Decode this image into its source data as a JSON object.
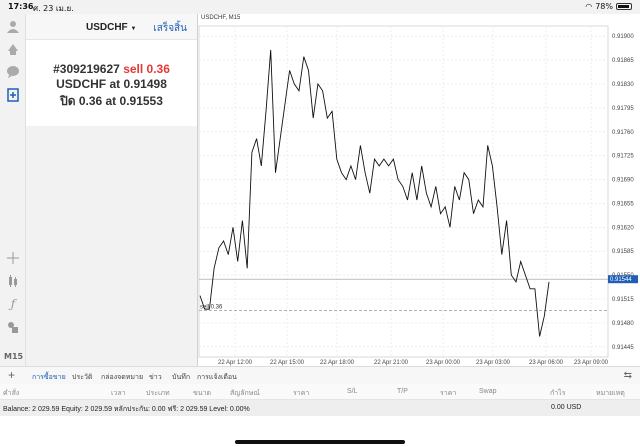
{
  "status_bar": {
    "time": "17:36",
    "date": "ศ. 23 เม.ย.",
    "battery": "78%",
    "battery_level": 0.78
  },
  "toolbar": {
    "icons": [
      "account-icon",
      "trade-icon",
      "chat-icon",
      "new-order-icon",
      "crosshair-icon",
      "candles-icon",
      "function-icon",
      "objects-icon"
    ],
    "timeframe": "M15"
  },
  "order_panel": {
    "symbol": "USDCHF",
    "done_label": "เสร็จสิ้น",
    "ticket": "#309219627",
    "action": "sell 0.36",
    "line2_prefix": "USDCHF at",
    "line2_price": "0.91498",
    "line3_prefix": "ปิด 0.36 at",
    "line3_price": "0.91553"
  },
  "chart": {
    "title": "USDCHF, M15",
    "level_label": "sell 0.36",
    "current_price_label": "0.91544",
    "accent_color": "#1f5fb5",
    "loss_color": "#e53935"
  },
  "chart_data": {
    "type": "line",
    "title": "USDCHF, M15",
    "xlabel": "",
    "ylabel": "",
    "ylim": [
      0.9143,
      0.91915
    ],
    "yticks": [
      "0.91900",
      "0.91865",
      "0.91830",
      "0.91795",
      "0.91760",
      "0.91725",
      "0.91690",
      "0.91655",
      "0.91620",
      "0.91585",
      "0.91550",
      "0.91515",
      "0.91480",
      "0.91445"
    ],
    "xticks": [
      "22 Apr 12:00",
      "22 Apr 15:00",
      "22 Apr 18:00",
      "22 Apr 21:00",
      "23 Apr 00:00",
      "23 Apr 03:00",
      "23 Apr 06:00",
      "23 Apr 09:00"
    ],
    "grid": true,
    "series": [
      {
        "values": [
          0.9152,
          0.915,
          0.915,
          0.9156,
          0.9159,
          0.916,
          0.9158,
          0.9162,
          0.9157,
          0.9163,
          0.9156,
          0.9173,
          0.9175,
          0.9171,
          0.9179,
          0.9188,
          0.917,
          0.9175,
          0.918,
          0.9185,
          0.9183,
          0.9182,
          0.9187,
          0.9185,
          0.9178,
          0.9183,
          0.9182,
          0.9178,
          0.9179,
          0.9172,
          0.917,
          0.9169,
          0.9171,
          0.9169,
          0.9174,
          0.917,
          0.9167,
          0.9172,
          0.9171,
          0.9172,
          0.9171,
          0.9172,
          0.9169,
          0.9168,
          0.9166,
          0.917,
          0.9166,
          0.9171,
          0.9167,
          0.9165,
          0.9168,
          0.9164,
          0.9165,
          0.9162,
          0.9168,
          0.9166,
          0.917,
          0.9169,
          0.9164,
          0.9166,
          0.9165,
          0.9174,
          0.9171,
          0.9165,
          0.9158,
          0.9163,
          0.9155,
          0.9154,
          0.9157,
          0.9155,
          0.9153,
          0.9153,
          0.9146,
          0.9149,
          0.9154
        ]
      }
    ],
    "reference_lines": [
      {
        "label": "sell 0.36",
        "value": 0.91498,
        "style": "dashed"
      },
      {
        "label": "0.91544",
        "value": 0.91544,
        "style": "solid"
      }
    ]
  },
  "terminal": {
    "tabs": [
      "การซื้อขาย",
      "ประวัติ",
      "กล่องจดหมาย",
      "ข่าว",
      "บันทึก",
      "การแจ้งเตือน"
    ],
    "active_tab": 0,
    "columns": [
      "คำสั่ง",
      "เวลา",
      "ประเภท",
      "ขนาด",
      "สัญลักษณ์",
      "ราคา",
      "S/L",
      "T/P",
      "ราคา",
      "Swap",
      "กำไร",
      "หมายเหตุ"
    ],
    "balance_text": "Balance: 2 029.59 Equity: 2 029.59 หลักประกัน: 0.00 ฟรี: 2 029.59 Level: 0.00%",
    "balance_value": "0.00 USD"
  }
}
